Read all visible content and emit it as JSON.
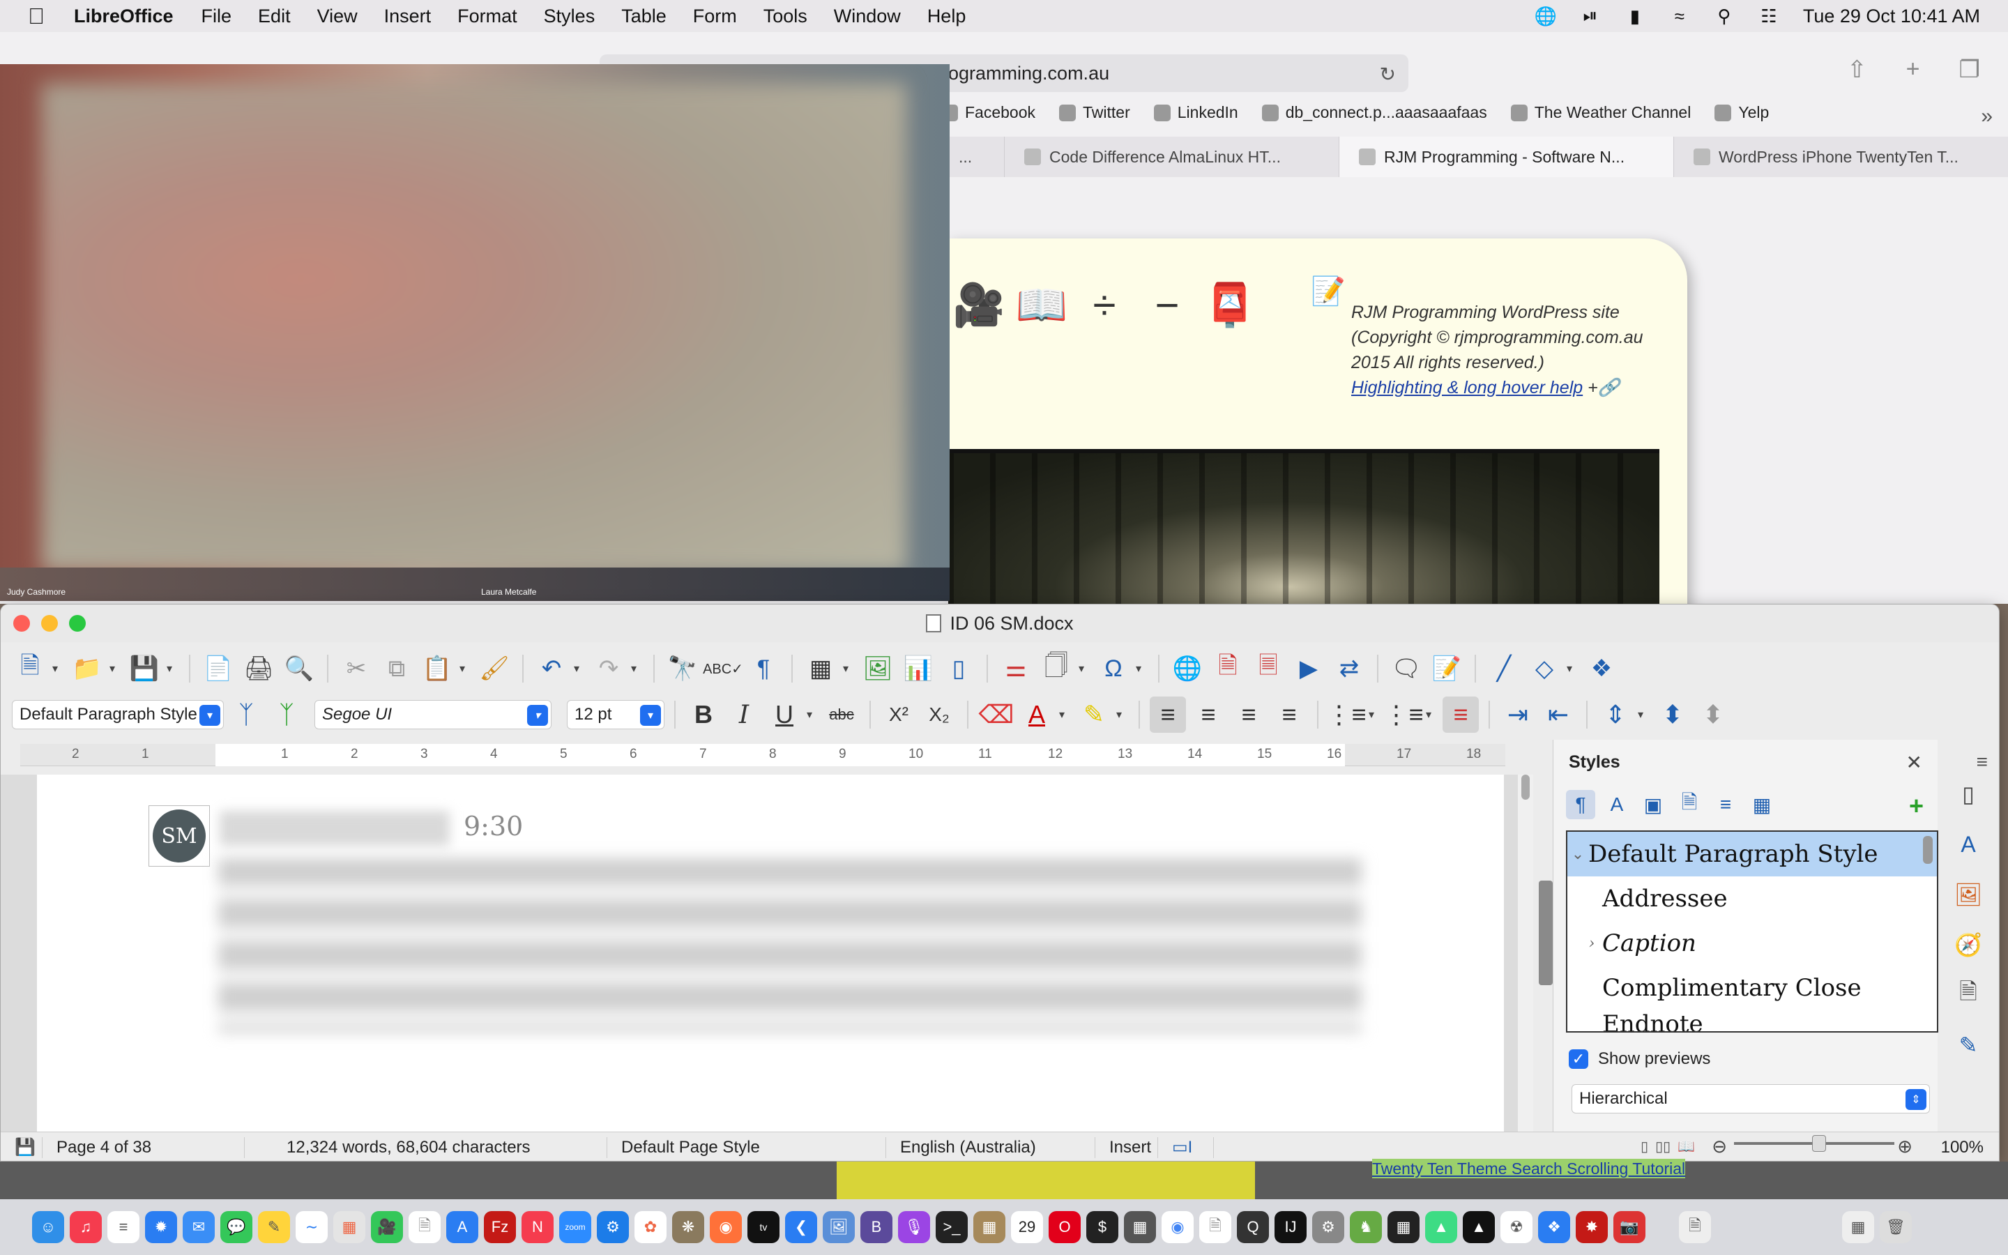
{
  "menubar": {
    "app_name": "LibreOffice",
    "items": [
      "File",
      "Edit",
      "View",
      "Insert",
      "Format",
      "Styles",
      "Table",
      "Form",
      "Tools",
      "Window",
      "Help"
    ],
    "clock": "Tue 29 Oct  10:41 AM"
  },
  "safari": {
    "url": "ogramming.com.au",
    "bookmarks": [
      "Facebook",
      "Twitter",
      "LinkedIn",
      "db_connect.p...aaasaaafaas",
      "The Weather Channel",
      "Yelp"
    ],
    "tabs": [
      {
        "label": "..."
      },
      {
        "label": "Code Difference AlmaLinux HT..."
      },
      {
        "label": "RJM Programming - Software N..."
      },
      {
        "label": "WordPress iPhone TwentyTen T..."
      }
    ],
    "web_credit_text": "RJM Programming WordPress site (Copyright © rjmprogramming.com.au 2015 All rights reserved.)",
    "web_link": "Highlighting & long hover help"
  },
  "video": {
    "name_left": "Judy Cashmore",
    "name_right": "Laura Metcalfe"
  },
  "writer": {
    "title": "ID 06 SM.docx",
    "paragraph_style": "Default Paragraph Style",
    "font_name": "Segoe UI",
    "font_size": "12 pt",
    "ruler_ticks": [
      "2",
      "1",
      "1",
      "2",
      "3",
      "4",
      "5",
      "6",
      "7",
      "8",
      "9",
      "10",
      "11",
      "12",
      "13",
      "14",
      "15",
      "16",
      "17",
      "18"
    ],
    "avatar_initials": "SM",
    "message_time": "9:30",
    "sidebar": {
      "title": "Styles",
      "styles": [
        {
          "label": "Default Paragraph Style",
          "selected": true,
          "expander": "⌄"
        },
        {
          "label": "Addressee",
          "selected": false,
          "expander": ""
        },
        {
          "label": "Caption",
          "selected": false,
          "expander": "›"
        },
        {
          "label": "Complimentary Close",
          "selected": false,
          "expander": ""
        },
        {
          "label": "Endnote",
          "selected": false,
          "expander": ""
        }
      ],
      "show_previews_label": "Show previews",
      "show_previews_checked": true,
      "filter_value": "Hierarchical"
    },
    "status": {
      "page": "Page 4 of 38",
      "words": "12,324 words, 68,604 characters",
      "page_style": "Default Page Style",
      "language": "English (Australia)",
      "mode": "Insert",
      "zoom": "100%"
    }
  },
  "behind": {
    "link_text": "Twenty Ten Theme Search Scrolling Tutorial"
  },
  "colors": {
    "accent": "#1f6ef0",
    "selection": "#b5d4f5",
    "close": "#fe5f57",
    "minimize": "#febc2e",
    "maximize": "#28c840"
  }
}
